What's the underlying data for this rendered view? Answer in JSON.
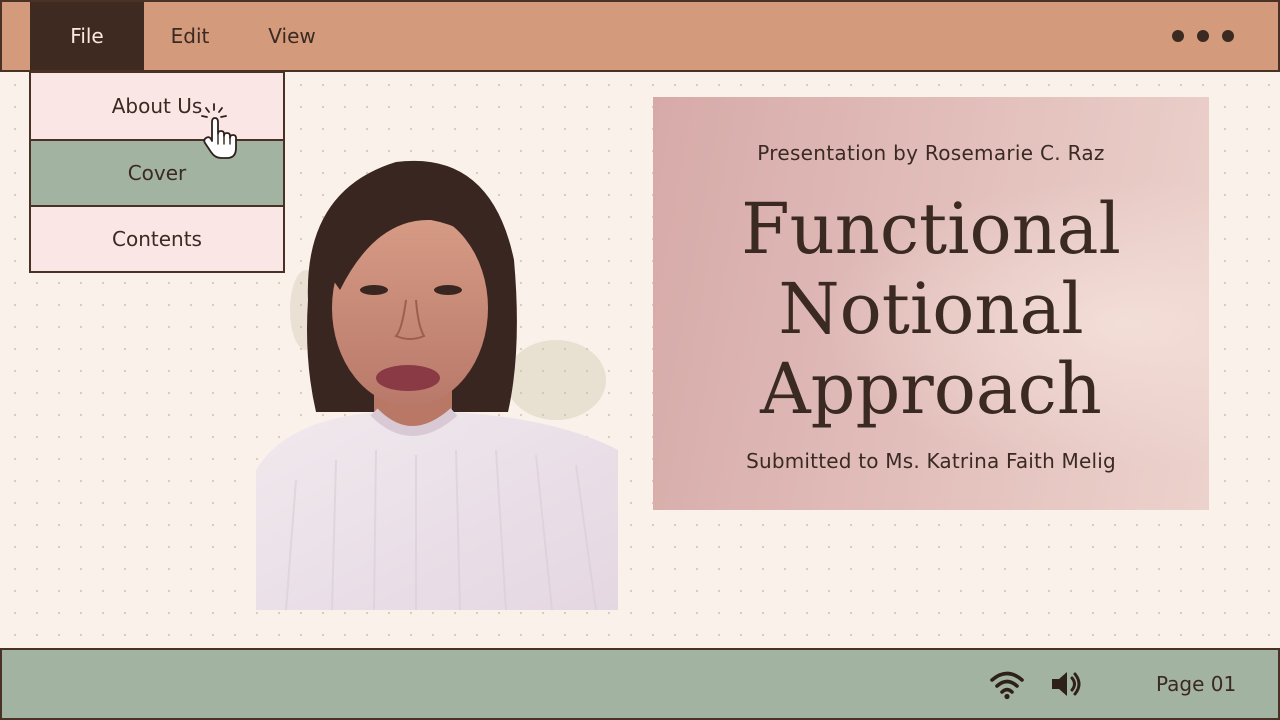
{
  "menubar": {
    "items": [
      {
        "label": "File"
      },
      {
        "label": "Edit"
      },
      {
        "label": "View"
      }
    ],
    "more_icon": "ellipsis-icon"
  },
  "dropdown": {
    "items": [
      {
        "label": "About Us"
      },
      {
        "label": "Cover",
        "active": true
      },
      {
        "label": "Contents"
      }
    ]
  },
  "slide": {
    "byline": "Presentation by Rosemarie C. Raz",
    "title_lines": [
      "Functional",
      "Notional",
      "Approach"
    ],
    "submitted": "Submitted to Ms. Katrina Faith Melig"
  },
  "statusbar": {
    "icons": [
      "wifi-icon",
      "speaker-icon"
    ],
    "page_label": "Page 01"
  },
  "colors": {
    "menubar": "#d49a7c",
    "menu_active": "#3e2a20",
    "dropdown_bg": "#fbe6e6",
    "dropdown_active": "#a3b3a1",
    "statusbar": "#a3b3a1",
    "card": "#dfb6b2",
    "text": "#3a2a22",
    "background": "#f9f1ea"
  }
}
